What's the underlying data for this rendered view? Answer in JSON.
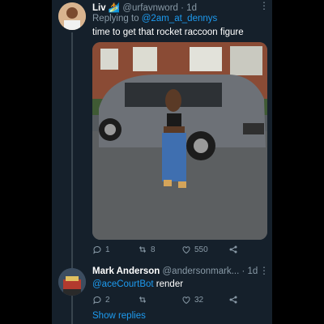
{
  "tweet1": {
    "display_name": "Liv",
    "name_emoji": "🏄",
    "handle": "@urfavnword",
    "time": "1d",
    "replying_prefix": "Replying to",
    "replying_handle": "@2am_at_dennys",
    "text": "time to get that rocket raccoon figure",
    "actions": {
      "replies": "1",
      "retweets": "8",
      "likes": "550"
    }
  },
  "tweet2": {
    "display_name": "Mark Anderson",
    "handle": "@andersonmark...",
    "time": "1d",
    "mention": "@aceCourtBot",
    "text_rest": " render",
    "actions": {
      "replies": "2",
      "retweets": "",
      "likes": "32"
    }
  },
  "show_replies": "Show replies",
  "colors": {
    "background": "#15202b",
    "accent": "#1d9bf0",
    "secondary_text": "#8899a6",
    "outer": "#000000"
  },
  "icons": [
    "more-icon",
    "reply-icon",
    "retweet-icon",
    "like-icon",
    "share-icon"
  ]
}
